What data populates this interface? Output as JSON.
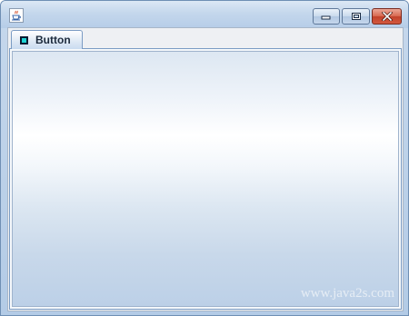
{
  "titlebar": {
    "icons": {
      "app": "java-coffee-icon",
      "minimize": "minimize-icon",
      "maximize": "maximize-icon",
      "close": "close-icon"
    }
  },
  "tabs": [
    {
      "label": "Button",
      "icon": "square-icon",
      "selected": true
    }
  ],
  "watermark": "www.java2s.com",
  "colors": {
    "tab_icon_fill": "#1fd3d3",
    "close_button": "#c2412a"
  }
}
